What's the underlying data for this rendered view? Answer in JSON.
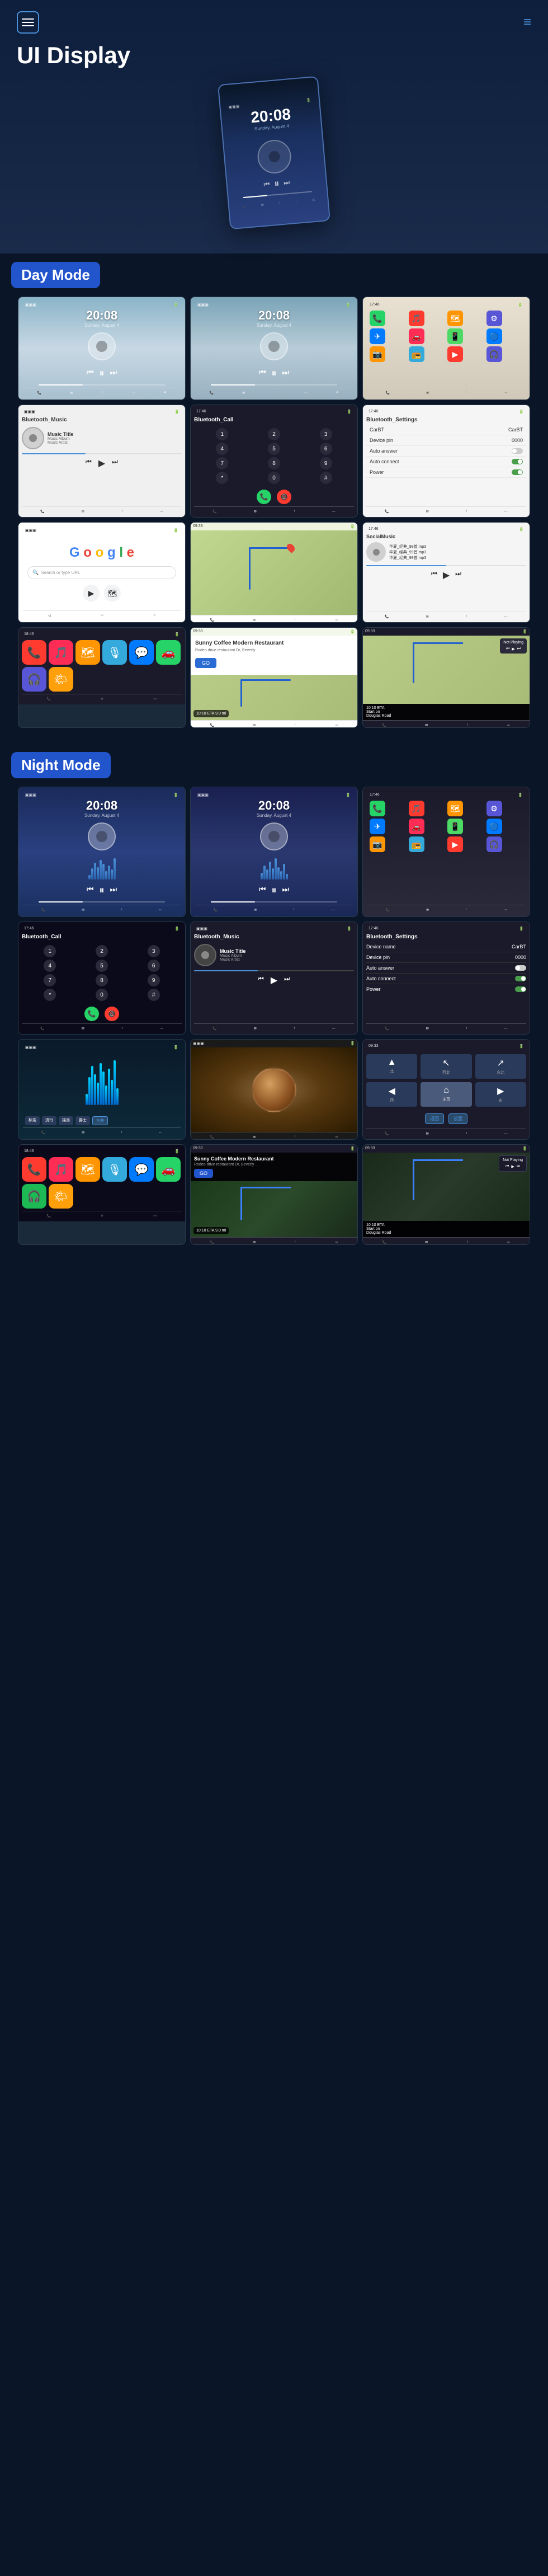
{
  "header": {
    "title": "UI Display",
    "menu_label": "menu",
    "nav_lines": "≡"
  },
  "day_mode": {
    "label": "Day Mode"
  },
  "night_mode": {
    "label": "Night Mode"
  },
  "screens": {
    "time": "20:08",
    "subtitle": "Sunday, August 4",
    "music_title": "Music Title",
    "music_album": "Music Album",
    "music_artist": "Music Artist",
    "bluetooth_music": "Bluetooth_Music",
    "bluetooth_call": "Bluetooth_Call",
    "bluetooth_settings": "Bluetooth_Settings",
    "device_name": "CarBT",
    "device_pin": "0000",
    "auto_answer": "Auto answer",
    "auto_connect": "Auto connect",
    "power": "Power",
    "google": "Google",
    "restaurant_name": "Sunny Coffee Modern Restaurant",
    "restaurant_addr": "Rodeo drive restaurant Dr, Beverly ...",
    "go_label": "GO",
    "eta": "10:10 ETA",
    "distance": "9.0 mi",
    "not_playing": "Not Playing",
    "start_on": "Start on",
    "douglas_road": "Douglas Road"
  },
  "icons": {
    "prev": "⏮",
    "play": "▶",
    "pause": "⏸",
    "next": "⏭",
    "menu": "☰",
    "nav": "—"
  }
}
